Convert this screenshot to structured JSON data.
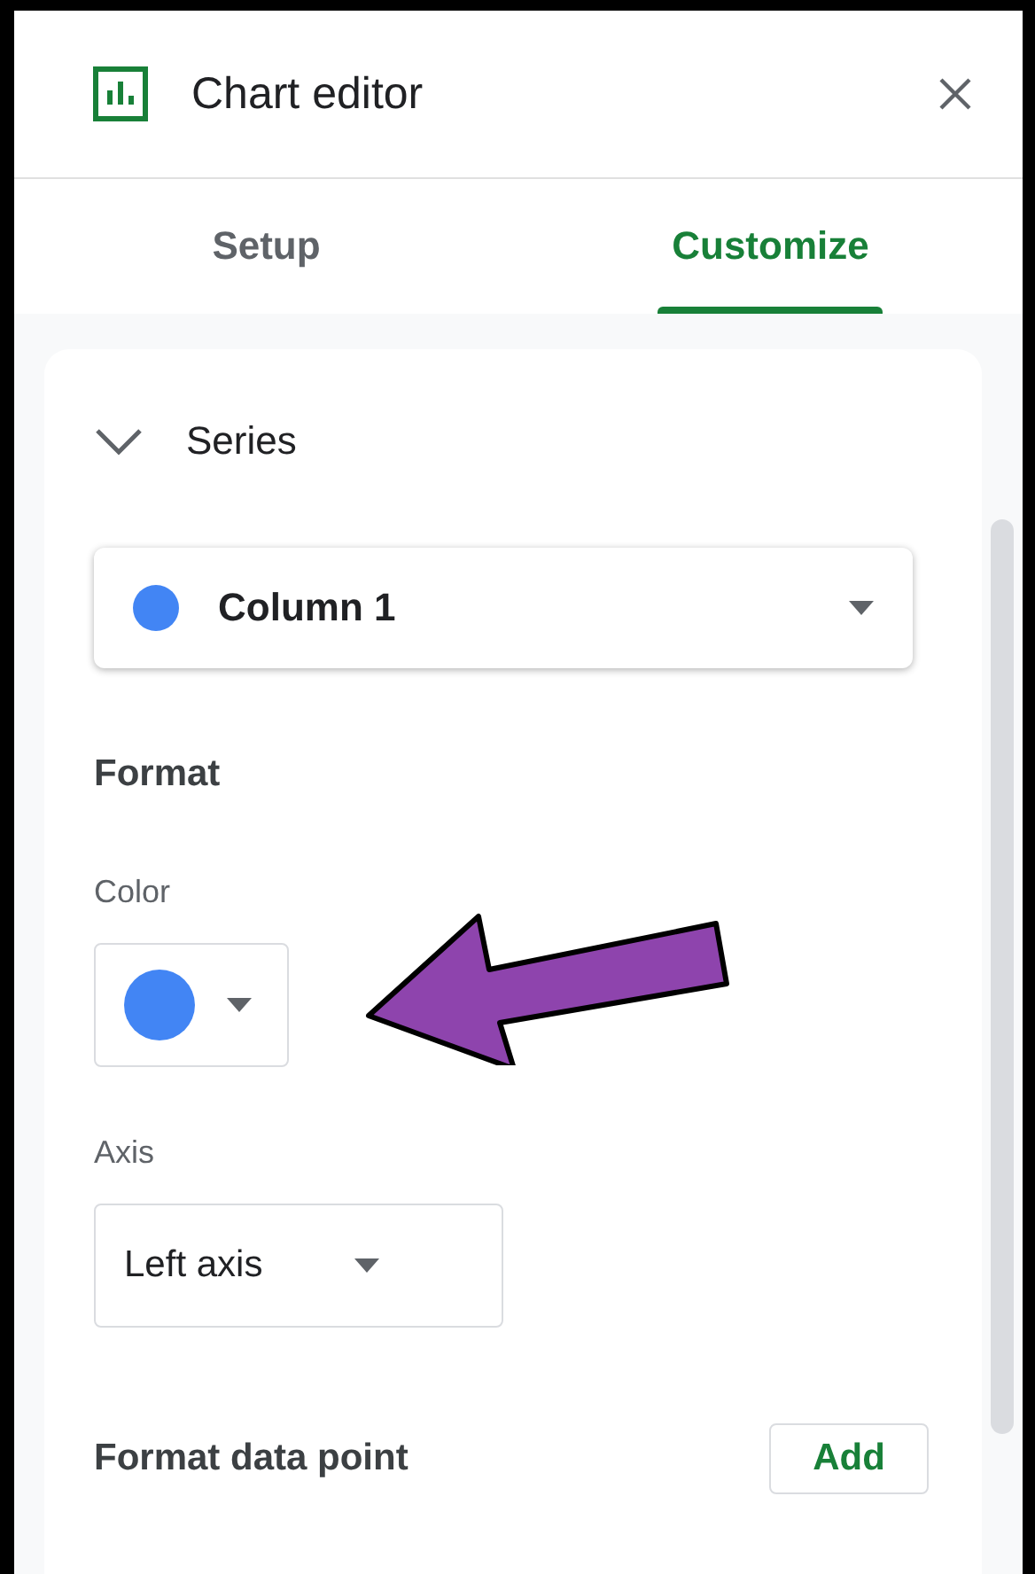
{
  "header": {
    "title": "Chart editor"
  },
  "tabs": [
    {
      "label": "Setup",
      "selected": false
    },
    {
      "label": "Customize",
      "selected": true
    }
  ],
  "series_section": {
    "title": "Series",
    "expanded": true
  },
  "series_select": {
    "value": "Column 1",
    "color": "#4285f4"
  },
  "format": {
    "heading": "Format",
    "color_label": "Color",
    "color": "#4285f4",
    "axis_label": "Axis",
    "axis_value": "Left axis"
  },
  "format_data_point": {
    "label": "Format data point",
    "button": "Add"
  }
}
